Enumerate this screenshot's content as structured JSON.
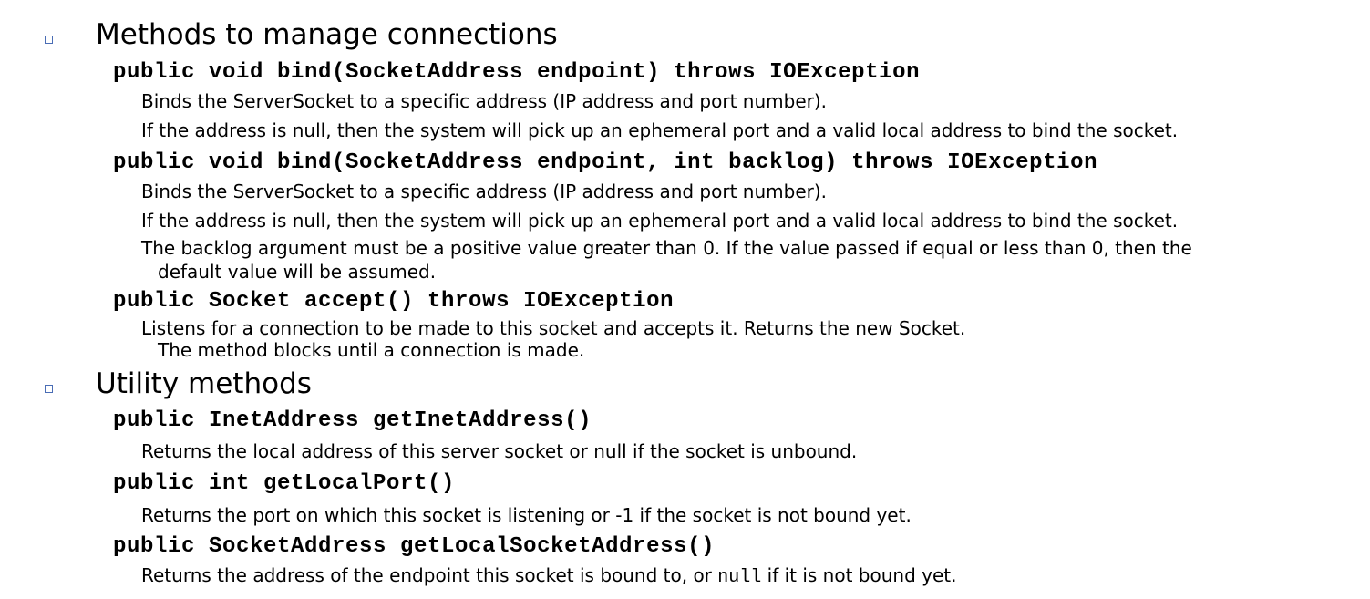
{
  "sections": [
    {
      "heading": "Methods to manage connections",
      "items": [
        {
          "signature": "public void bind(SocketAddress endpoint) throws IOException",
          "lines": [
            "Binds the ServerSocket to a specific address (IP address and port number).",
            "If the address is null, then the system will pick up an ephemeral port and a valid local address to bind the socket."
          ]
        },
        {
          "signature": "public void bind(SocketAddress endpoint, int backlog) throws IOException",
          "lines": [
            "Binds the ServerSocket to a specific address (IP address and port number).",
            "If the address is null, then the system will pick up an ephemeral port and a valid local address to bind the socket.",
            "The backlog argument must be a positive value greater than 0. If the value passed if equal or less than 0, then the",
            "default value will be assumed."
          ]
        },
        {
          "signature": "public Socket accept() throws IOException",
          "lines": [
            "Listens for a connection to be made to this socket and accepts it. Returns the new Socket.",
            "The method blocks until a connection is made."
          ]
        }
      ]
    },
    {
      "heading": "Utility methods",
      "items": [
        {
          "signature": "public InetAddress getInetAddress()",
          "lines": [
            "Returns the local address of this server socket or null if the socket is unbound."
          ]
        },
        {
          "signature": "public int getLocalPort()",
          "lines": [
            "Returns the port on which this socket is listening or -1 if the socket is not bound yet."
          ]
        },
        {
          "signature": "public SocketAddress getLocalSocketAddress()",
          "lines": [
            "Returns the address of the endpoint this socket is bound to, or ",
            "null",
            " if it is not bound yet."
          ]
        }
      ]
    }
  ]
}
